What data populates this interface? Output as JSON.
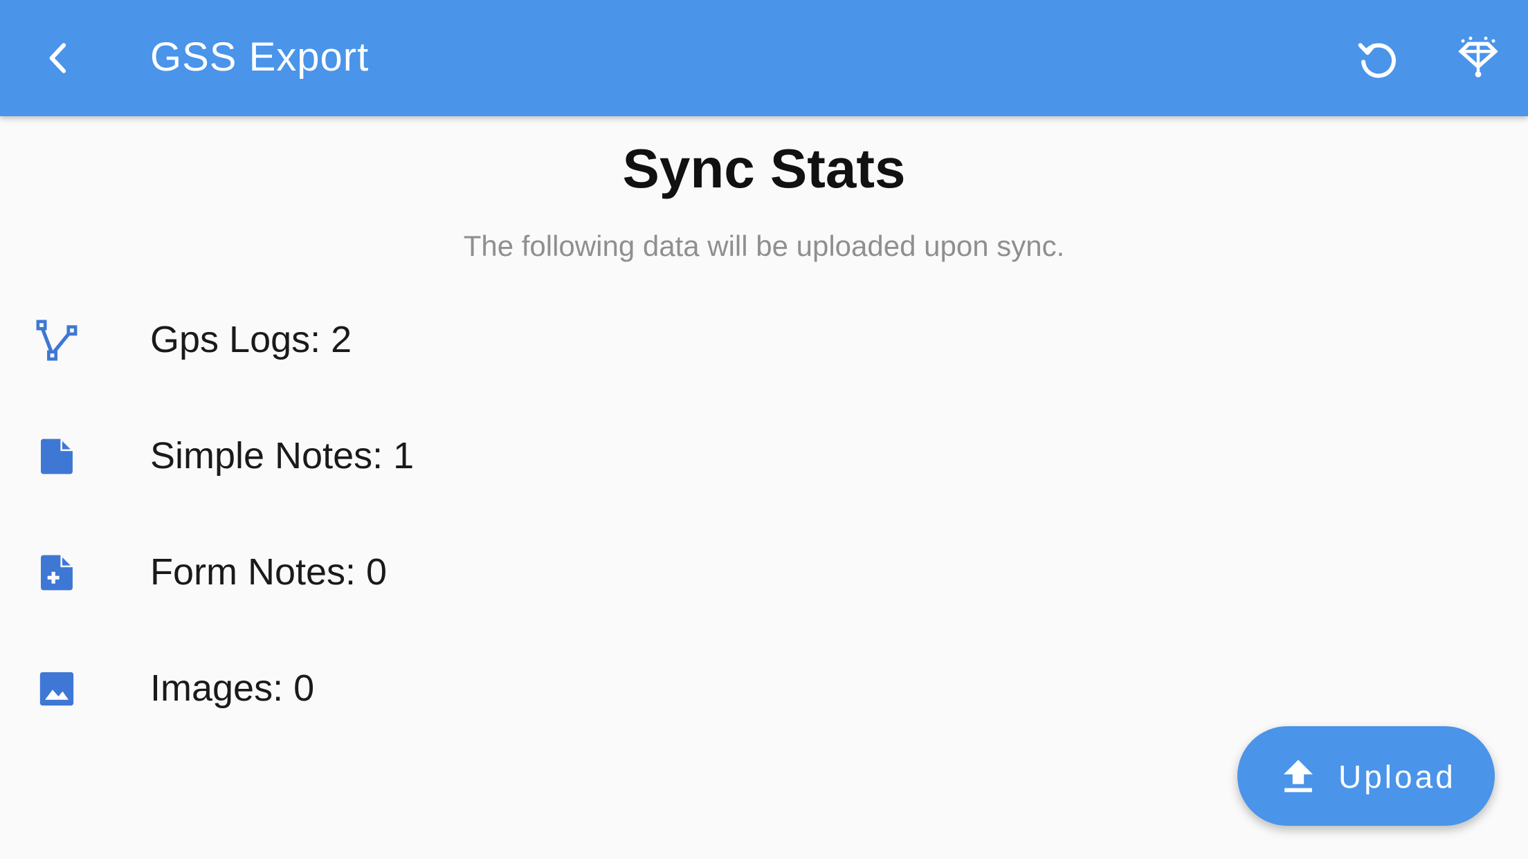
{
  "appbar": {
    "title": "GSS Export",
    "back_icon": "back-arrow-icon",
    "actions": [
      "refresh-icon",
      "geo-position-icon"
    ]
  },
  "main": {
    "heading": "Sync Stats",
    "subtitle": "The following data will be uploaded upon sync.",
    "stats": [
      {
        "icon": "gps-log-icon",
        "label": "Gps Logs: 2"
      },
      {
        "icon": "simple-note-icon",
        "label": "Simple Notes: 1"
      },
      {
        "icon": "form-note-icon",
        "label": "Form Notes: 0"
      },
      {
        "icon": "image-icon",
        "label": "Images: 0"
      }
    ]
  },
  "fab": {
    "label": "Upload",
    "icon": "upload-icon"
  },
  "colors": {
    "primary": "#4a94ea",
    "icon_blue": "#3e78d4",
    "background": "#fafafa",
    "subtitle_gray": "#8f8f8f"
  }
}
